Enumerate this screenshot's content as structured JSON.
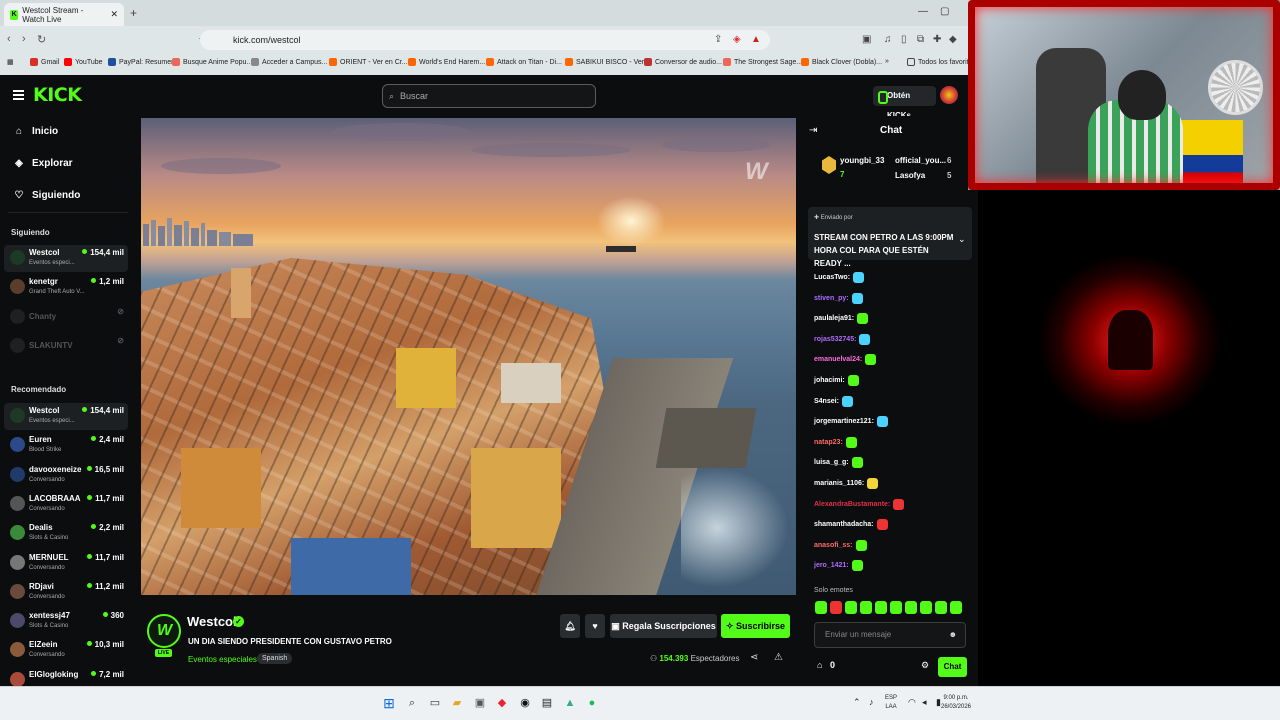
{
  "browser": {
    "tab_title": "Westcol Stream - Watch Live",
    "tab_favicon": "K",
    "url": "kick.com/westcol",
    "bookmarks": [
      "Gmail",
      "YouTube",
      "PayPal: Resumen",
      "Busque Anime Popu...",
      "Acceder a Campus...",
      "ORIENT - Ver en Cr...",
      "World's End Harem...",
      "Attack on Titan - Di...",
      "SABIKUI BISCO - Ver...",
      "Conversor de audio...",
      "The Strongest Sage...",
      "Black Clover (Dobla)...",
      "Todos los favoritos"
    ],
    "overflow": "»"
  },
  "header": {
    "logo": "KICK",
    "search_placeholder": "Buscar",
    "kicks_label": "Obtén KICKs"
  },
  "sidebar": {
    "nav": [
      {
        "label": "Inicio",
        "icon": "home-icon"
      },
      {
        "label": "Explorar",
        "icon": "compass-icon"
      },
      {
        "label": "Siguiendo",
        "icon": "heart-icon"
      }
    ],
    "following_title": "Siguiendo",
    "following": [
      {
        "name": "Westcol",
        "category": "Eventos especi...",
        "viewers": "154,4 mil",
        "color": "#1c3a25"
      },
      {
        "name": "kenetgr",
        "category": "Grand Theft Auto V...",
        "viewers": "1,2 mil",
        "color": "#5a3d2a"
      },
      {
        "name": "Chanty",
        "category": "",
        "viewers": "",
        "offline": true
      },
      {
        "name": "SLAKUNTV",
        "category": "",
        "viewers": "",
        "offline": true
      }
    ],
    "recommended_title": "Recomendado",
    "recommended": [
      {
        "name": "Westcol",
        "category": "Eventos especi...",
        "viewers": "154,4 mil",
        "color": "#1c3a25"
      },
      {
        "name": "Euren",
        "category": "Blood Strike",
        "viewers": "2,4 mil",
        "color": "#2b4a8a"
      },
      {
        "name": "davooxeneize",
        "category": "Conversando",
        "viewers": "16,5 mil",
        "color": "#203a6a"
      },
      {
        "name": "LACOBRAAA",
        "category": "Conversando",
        "viewers": "11,7 mil",
        "color": "#555"
      },
      {
        "name": "Dealis",
        "category": "Slots & Casino",
        "viewers": "2,2 mil",
        "color": "#3a8a3a"
      },
      {
        "name": "MERNUEL",
        "category": "Conversando",
        "viewers": "11,7 mil",
        "color": "#777"
      },
      {
        "name": "RDjavi",
        "category": "Conversando",
        "viewers": "11,2 mil",
        "color": "#6a4a3a"
      },
      {
        "name": "xentessj47",
        "category": "Slots & Casino",
        "viewers": "360",
        "color": "#4a4a6a"
      },
      {
        "name": "ElZeein",
        "category": "Conversando",
        "viewers": "10,3 mil",
        "color": "#8a5a3a"
      },
      {
        "name": "ElGlogloking",
        "category": "",
        "viewers": "7,2 mil",
        "color": "#aa4a3a"
      }
    ]
  },
  "stream": {
    "channel": "Westcol",
    "live_badge": "LIVE",
    "title": "UN DIA SIENDO PRESIDENTE CON GUSTAVO PETRO",
    "category": "Eventos especiales",
    "language": "Spanish",
    "gift_label": "Regala Suscripciones",
    "subscribe_label": "Suscribirse",
    "viewer_count": "154.393",
    "viewer_label": "Espectadores"
  },
  "chat": {
    "title": "Chat",
    "gifters": [
      {
        "name": "youngbi_33",
        "count": "7"
      },
      {
        "name": "official_you...",
        "count": "6"
      },
      {
        "name": "Lasofya",
        "count": "5"
      }
    ],
    "pinned_by": "Enviado por",
    "pinned_text": "STREAM CON PETRO A LAS 9:00PM HORA COL PARA QUE ESTÉN READY ...",
    "messages": [
      {
        "user": "LucasTwo:",
        "color": "#ffffff",
        "emote": "b"
      },
      {
        "user": "stiven_py:",
        "color": "#b06cff",
        "emote": "b"
      },
      {
        "user": "paulaleja91:",
        "color": "#ffffff",
        "emote": "g"
      },
      {
        "user": "rojas532745:",
        "color": "#b06cff",
        "emote": "b"
      },
      {
        "user": "emanuelval24:",
        "color": "#ff6ae0",
        "emote": "g"
      },
      {
        "user": "johacimi:",
        "color": "#ffffff",
        "emote": "g"
      },
      {
        "user": "S4nsei:",
        "color": "#ffffff",
        "emote": "b"
      },
      {
        "user": "jorgemartinez121:",
        "color": "#ffffff",
        "emote": "b"
      },
      {
        "user": "natap23:",
        "color": "#ff6a6a",
        "emote": "g"
      },
      {
        "user": "luisa_g_g:",
        "color": "#ffffff",
        "emote": "g"
      },
      {
        "user": "marianis_1106:",
        "color": "#ffffff",
        "emote": "y"
      },
      {
        "user": "AlexandraBustamante:",
        "color": "#e0304a",
        "emote": "r"
      },
      {
        "user": "shamanthadacha:",
        "color": "#ffffff",
        "emote": "r"
      },
      {
        "user": "anasofi_ss:",
        "color": "#ff6a6a",
        "emote": "g"
      },
      {
        "user": "jero_1421:",
        "color": "#b06cff",
        "emote": "g"
      }
    ],
    "emotes_only": "Solo emotes",
    "input_placeholder": "Enviar un mensaje",
    "points": "0",
    "send_label": "Chat"
  },
  "taskbar": {
    "lang": "ESP",
    "lang2": "LAA",
    "time": "9:00 p.m.",
    "date": "26/03/2026"
  },
  "colors": {
    "accent": "#53fc18",
    "background": "#0b0d0e"
  }
}
